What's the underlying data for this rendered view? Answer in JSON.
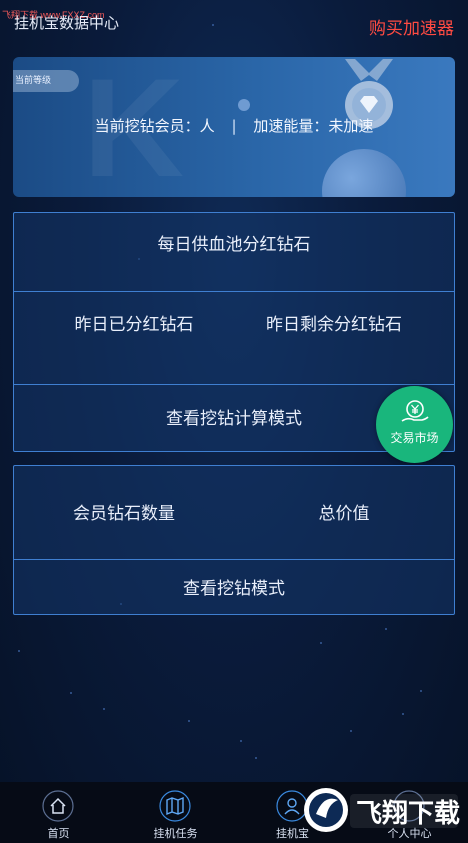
{
  "header": {
    "watermark": "飞翔下载 www.FXXZ.com",
    "title": "挂机宝数据中心",
    "buy_label": "购买加速器"
  },
  "level_card": {
    "badge": "当前等级",
    "member_label": "当前挖钻会员：人",
    "separator": "|",
    "energy_label": "加速能量：未加速"
  },
  "dividend_panel": {
    "daily_pool": "每日供血池分红钻石",
    "yesterday_distributed": "昨日已分红钻石",
    "yesterday_remaining": "昨日剩余分红钻石",
    "calc_mode_link": "查看挖钻计算模式"
  },
  "member_panel": {
    "diamond_count": "会员钻石数量",
    "total_value": "总价值",
    "mode_link": "查看挖钻模式"
  },
  "fab": {
    "label": "交易市场",
    "icon": "yen-hand-icon"
  },
  "tabbar": {
    "items": [
      {
        "label": "首页",
        "icon": "home-icon"
      },
      {
        "label": "挂机任务",
        "icon": "map-icon"
      },
      {
        "label": "挂机宝",
        "icon": "user-icon"
      },
      {
        "label": "个人中心",
        "icon": "profile-icon"
      }
    ]
  },
  "site_logo": {
    "text": "飞翔下载"
  },
  "colors": {
    "accent_red": "#ff4b42",
    "border_blue": "#3f7fd1",
    "fab_green": "#19b67c"
  }
}
